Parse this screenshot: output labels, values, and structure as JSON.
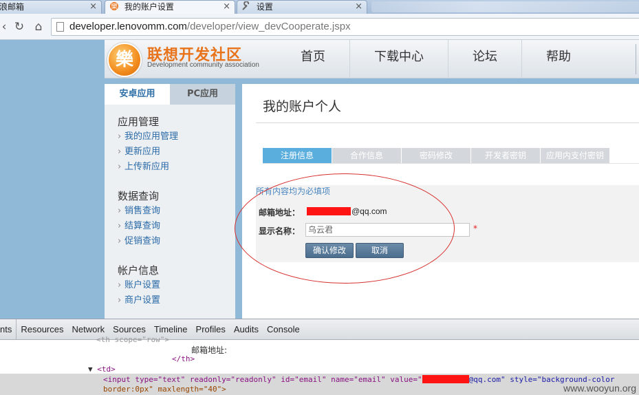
{
  "browser": {
    "tabs": [
      {
        "label": "浪邮箱"
      },
      {
        "label": "我的账户设置"
      },
      {
        "label": "设置"
      }
    ],
    "url_host": "developer.lenovomm.com",
    "url_path": "/developer/view_devCooperate.jspx"
  },
  "header": {
    "logo_title": "联想开发社区",
    "logo_sub": "Development community association",
    "logo_glyph": "樂",
    "nav": [
      "首页",
      "下载中心",
      "论坛",
      "帮助"
    ]
  },
  "sidebar": {
    "tabs": [
      "安卓应用",
      "PC应用"
    ],
    "groups": [
      {
        "title": "应用管理",
        "links": [
          "我的应用管理",
          "更新应用",
          "上传新应用"
        ]
      },
      {
        "title": "数据查询",
        "links": [
          "销售查询",
          "结算查询",
          "促销查询"
        ]
      },
      {
        "title": "帐户信息",
        "links": [
          "账户设置",
          "商户设置"
        ]
      }
    ]
  },
  "main": {
    "title": "我的账户个人",
    "form_tabs": [
      "注册信息",
      "合作信息",
      "密码修改",
      "开发者密钥",
      "应用内支付密钥"
    ],
    "required_note": "所有内容均为必填项",
    "email_label": "邮箱地址：",
    "email_suffix": "@qq.com",
    "name_label": "显示名称：",
    "name_value": "乌云君",
    "required_mark": "*",
    "confirm_button": "确认修改",
    "cancel_button": "取消"
  },
  "devtools": {
    "tabs": [
      "nts",
      "Resources",
      "Network",
      "Sources",
      "Timeline",
      "Profiles",
      "Audits",
      "Console"
    ],
    "code_top": "<th scope=\"row\">",
    "code_label": "邮箱地址:",
    "code_th_close": "</th>",
    "code_td": "<td>",
    "code_input_a": "<input type=\"text\" readonly=\"readonly\" id=\"email\" name=\"email\" value=\"",
    "code_input_b": "@qq.com\" style=\"background-color",
    "code_input_c": "border:0px\" maxlength=\"40\">",
    "expand_arrow": "▼"
  },
  "watermark": "www.wooyun.org",
  "colors": {
    "accent": "#5aaede",
    "brand_orange": "#e8731a",
    "annotation": "#d83030",
    "redaction": "#ff1414"
  }
}
